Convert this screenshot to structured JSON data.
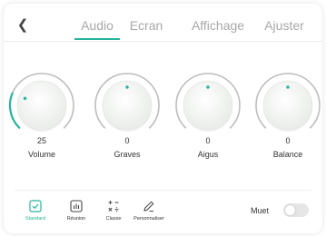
{
  "header": {
    "back_icon": "chevron-left-icon",
    "tabs": [
      {
        "label": "Audio",
        "active": true
      },
      {
        "label": "Ecran",
        "active": false
      },
      {
        "label": "Affichage",
        "active": false
      },
      {
        "label": "Ajuster",
        "active": false
      }
    ]
  },
  "knobs": [
    {
      "label": "Volume",
      "value": "25",
      "level": 25,
      "min": 0,
      "max": 100
    },
    {
      "label": "Graves",
      "value": "0",
      "level": 0,
      "min": -50,
      "max": 50
    },
    {
      "label": "Aigus",
      "value": "0",
      "level": 0,
      "min": -50,
      "max": 50
    },
    {
      "label": "Balance",
      "value": "0",
      "level": 0,
      "min": -50,
      "max": 50
    }
  ],
  "modes": [
    {
      "label": "Standard",
      "icon": "checkbox-icon",
      "active": true
    },
    {
      "label": "Réunion",
      "icon": "chart-box-icon",
      "active": false
    },
    {
      "label": "Classe",
      "icon": "math-operators-icon",
      "active": false
    },
    {
      "label": "Personnaliser",
      "icon": "pencil-icon",
      "active": false
    }
  ],
  "mute": {
    "label": "Muet",
    "enabled": false
  },
  "colors": {
    "accent": "#26b59b",
    "track": "#bdbdbd",
    "tab_inactive": "#a8a8a8",
    "toggle_off": "#e6e6e6"
  }
}
